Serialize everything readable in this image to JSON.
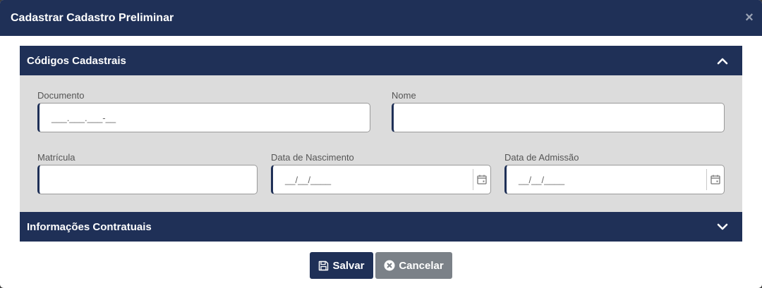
{
  "modal": {
    "title": "Cadastrar Cadastro Preliminar",
    "close_glyph": "×"
  },
  "sections": {
    "codigos": {
      "title": "Códigos Cadastrais",
      "expanded": true
    },
    "contratuais": {
      "title": "Informações Contratuais",
      "expanded": false
    }
  },
  "fields": {
    "documento": {
      "label": "Documento",
      "value": "___.___.___-__"
    },
    "nome": {
      "label": "Nome",
      "value": ""
    },
    "matricula": {
      "label": "Matrícula",
      "value": ""
    },
    "data_nascimento": {
      "label": "Data de Nascimento",
      "value": "__/__/____"
    },
    "data_admissao": {
      "label": "Data de Admissão",
      "value": "__/__/____"
    }
  },
  "buttons": {
    "save_label": "Salvar",
    "cancel_label": "Cancelar"
  },
  "colors": {
    "primary": "#1f3057",
    "panel_bg": "#dcdcdc",
    "cancel": "#7b8188"
  }
}
